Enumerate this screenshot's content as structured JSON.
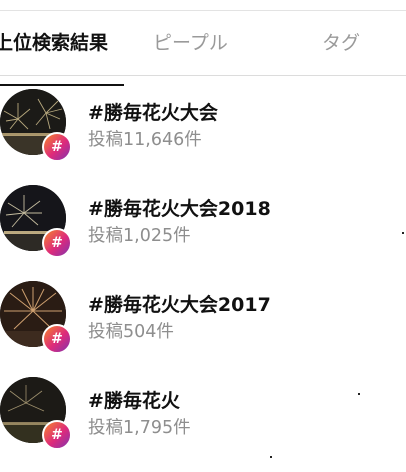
{
  "tabs": [
    {
      "label": "上位検索結果",
      "active": true
    },
    {
      "label": "ピープル",
      "active": false
    },
    {
      "label": "タグ",
      "active": false
    }
  ],
  "results": [
    {
      "title": "#勝毎花火大会",
      "subtitle": "投稿11,646件",
      "badge": "#"
    },
    {
      "title": "#勝毎花火大会2018",
      "subtitle": "投稿1,025件",
      "badge": "#"
    },
    {
      "title": "#勝毎花火大会2017",
      "subtitle": "投稿504件",
      "badge": "#"
    },
    {
      "title": "#勝毎花火",
      "subtitle": "投稿1,795件",
      "badge": "#"
    }
  ],
  "colors": {
    "active_tab": "#111111",
    "inactive_tab": "#9a9a9a",
    "subtitle": "#8e8e8e",
    "badge_gradient": [
      "#f58529",
      "#dd2a7b",
      "#8134af"
    ]
  }
}
